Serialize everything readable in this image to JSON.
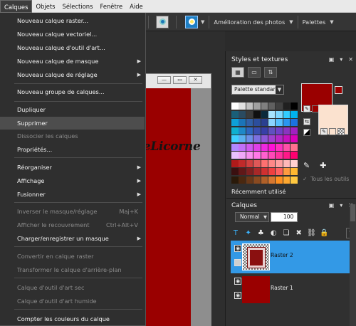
{
  "menubar": {
    "items": [
      {
        "label": "Calques",
        "active": true
      },
      {
        "label": "Objets",
        "active": false
      },
      {
        "label": "Sélections",
        "active": false
      },
      {
        "label": "Fenêtre",
        "active": false
      },
      {
        "label": "Aide",
        "active": false
      }
    ]
  },
  "toolbar": {
    "photo_fix_label": "Amélioration des photos",
    "palettes_label": "Palettes"
  },
  "menu": {
    "items": [
      {
        "label": "Nouveau calque raster...",
        "enabled": true
      },
      {
        "label": "Nouveau calque vectoriel...",
        "enabled": true
      },
      {
        "label": "Nouveau calque d'outil d'art...",
        "enabled": true
      },
      {
        "label": "Nouveau calque de masque",
        "enabled": true,
        "submenu": true
      },
      {
        "label": "Nouveau calque de réglage",
        "enabled": true,
        "submenu": true
      },
      {
        "label": "Nouveau groupe de calques...",
        "enabled": true
      },
      {
        "label": "Dupliquer",
        "enabled": true
      },
      {
        "label": "Supprimer",
        "enabled": true,
        "highlighted": true
      },
      {
        "label": "Dissocier les calques",
        "enabled": false
      },
      {
        "label": "Propriétés...",
        "enabled": true
      },
      {
        "label": "Réorganiser",
        "enabled": true,
        "submenu": true
      },
      {
        "label": "Affichage",
        "enabled": true,
        "submenu": true
      },
      {
        "label": "Fusionner",
        "enabled": true,
        "submenu": true
      },
      {
        "label": "Inverser le masque/réglage",
        "enabled": false,
        "shortcut": "Maj+K"
      },
      {
        "label": "Afficher le recouvrement",
        "enabled": false,
        "shortcut": "Ctrl+Alt+V"
      },
      {
        "label": "Charger/enregistrer un masque",
        "enabled": true,
        "submenu": true
      },
      {
        "label": "Convertir en calque raster",
        "enabled": false
      },
      {
        "label": "Transformer le calque d'arrière-plan",
        "enabled": false
      },
      {
        "label": "Calque d'outil d'art sec",
        "enabled": false
      },
      {
        "label": "Calque d'outil d'art humide",
        "enabled": false
      },
      {
        "label": "Compter les couleurs du calque",
        "enabled": true
      }
    ]
  },
  "canvas": {
    "watermark": "PetiteLicorne",
    "fill_color": "#9a0000"
  },
  "styles_panel": {
    "title": "Styles et textures",
    "palette_select": "Palette standard",
    "foreground_color": "#9a0000",
    "background_color": "#fbe2cf",
    "all_tools_label": "Tous les outils",
    "recent_label": "Récemment utilisé",
    "swatch_colors": [
      "#ffffff",
      "#e0e0e0",
      "#c0c0c0",
      "#a0a0a0",
      "#808080",
      "#606060",
      "#404040",
      "#202020",
      "#000000",
      "#1a5f78",
      "#2a4a60",
      "#3a3a3a",
      "#101010",
      "#0b2a3a",
      "#a7e5ff",
      "#7fd8ff",
      "#33ccff",
      "#00b2ee",
      "#0ea0d8",
      "#1b74b8",
      "#3060a8",
      "#2c4e9c",
      "#2a4090",
      "#8ad4ff",
      "#55c0ff",
      "#2a96f0",
      "#1c72e0",
      "#0fb0d0",
      "#1e88c8",
      "#2e66c0",
      "#3a4eb0",
      "#383fa8",
      "#6050c0",
      "#7040c8",
      "#8a34c0",
      "#a020c0",
      "#3fd0ff",
      "#5ab0f0",
      "#6a90e8",
      "#7c70e0",
      "#8c58d8",
      "#a040d0",
      "#b428c8",
      "#c810c0",
      "#d800b8",
      "#b088ff",
      "#c070f8",
      "#d058f0",
      "#e040e8",
      "#f028e0",
      "#ff10d8",
      "#ff30c0",
      "#ff50a8",
      "#ff7090",
      "#e8c0ff",
      "#f0a8f8",
      "#f890f0",
      "#ff78e8",
      "#ff60d0",
      "#ff48b8",
      "#ff30a0",
      "#ff1888",
      "#ff0070",
      "#b01a1a",
      "#c02a2a",
      "#d04040",
      "#e05858",
      "#ff7070",
      "#ff8888",
      "#ffa0a0",
      "#ffb8b8",
      "#ffd0d0",
      "#3a1010",
      "#601818",
      "#802020",
      "#a82828",
      "#d03030",
      "#f04040",
      "#ff6060",
      "#ff9a40",
      "#ffb830",
      "#2a1a0a",
      "#4a2810",
      "#6a3818",
      "#8a4a20",
      "#b06028",
      "#d87830",
      "#ff9020",
      "#ffa830",
      "#ffc840"
    ]
  },
  "layers_panel": {
    "title": "Calques",
    "blend_mode": "Normal",
    "opacity": "100",
    "layers": [
      {
        "name": "Raster 2",
        "selected": true
      },
      {
        "name": "Raster 1",
        "selected": false
      }
    ]
  }
}
